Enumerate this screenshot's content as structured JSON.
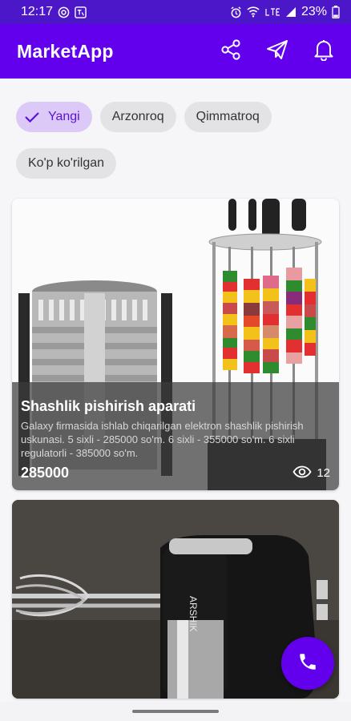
{
  "status_bar": {
    "time": "12:17",
    "battery": "23%"
  },
  "app_bar": {
    "title": "MarketApp",
    "actions": [
      "share-icon",
      "send-icon",
      "notifications-icon"
    ]
  },
  "filters": [
    {
      "label": "Yangi",
      "selected": true
    },
    {
      "label": "Arzonroq",
      "selected": false
    },
    {
      "label": "Qimmatroq",
      "selected": false
    },
    {
      "label": "Ko'p ko'rilgan",
      "selected": false
    }
  ],
  "products": [
    {
      "title": "Shashlik pishirish aparati",
      "description": "Galaxy firmasida ishlab chiqarilgan elektron shashlik pishirish uskunasi. 5 sixli - 285000 so'm. 6 sixli - 355000 so'm. 6 sixli regulatorli - 385000 so'm.",
      "price": "285000",
      "views": "12"
    },
    {
      "image_label": "ARSHIK"
    }
  ],
  "fab": {
    "icon": "phone-icon"
  },
  "colors": {
    "primary": "#6200ee",
    "status_bar": "#4b17c9",
    "chip_selected_bg": "#dcc9f7",
    "chip_bg": "#e3e3e6"
  }
}
